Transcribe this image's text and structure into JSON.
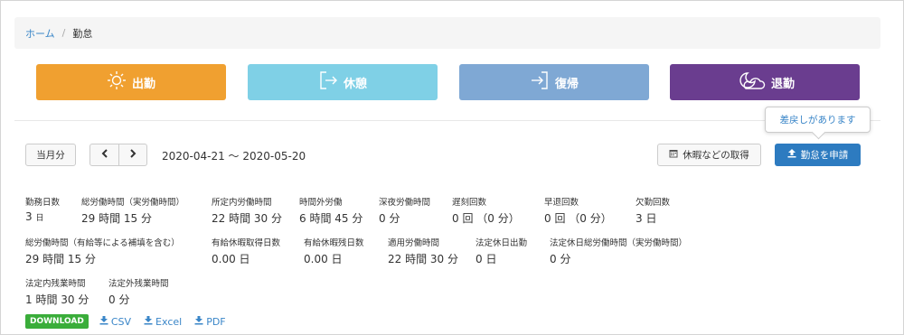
{
  "breadcrumb": {
    "home": "ホーム",
    "separator": "/",
    "current": "勤怠"
  },
  "actions": {
    "clock_in": "出勤",
    "break": "休憩",
    "return": "復帰",
    "clock_out": "退勤"
  },
  "colors": {
    "clock_in": "#f0a030",
    "break": "#7fd0e6",
    "return": "#7fa8d4",
    "clock_out": "#6a3d8f",
    "link": "#3a86c8",
    "apply": "#2d7bc0",
    "download_badge": "#3aad3a"
  },
  "tooltip": "差戻しがあります",
  "controls": {
    "this_month": "当月分",
    "prev_icon": "chevron-left-icon",
    "next_icon": "chevron-right-icon",
    "date_range": "2020-04-21 〜 2020-05-20",
    "leave_request": "休暇などの取得",
    "apply": "勤怠を申請"
  },
  "stats": [
    {
      "label": "勤務日数",
      "value": "3",
      "unit": "日"
    },
    {
      "label": "総労働時間（実労働時間）",
      "value": "29 時間 15 分"
    },
    {
      "label": "所定内労働時間",
      "value": "22 時間 30 分"
    },
    {
      "label": "時間外労働",
      "value": "6 時間 45 分"
    },
    {
      "label": "深夜労働時間",
      "value": "0 分"
    },
    {
      "label": "遅刻回数",
      "value": "0 回 （0 分）"
    },
    {
      "label": "早退回数",
      "value": "0 回 （0 分）"
    },
    {
      "label": "欠勤回数",
      "value": "3 日"
    },
    {
      "label": "総労働時間（有給等による補填を含む）",
      "value": "29 時間 15 分"
    },
    {
      "label": "有給休暇取得日数",
      "value": "0.00 日"
    },
    {
      "label": "有給休暇残日数",
      "value": "0.00 日"
    },
    {
      "label": "適用労働時間",
      "value": "22 時間 30 分"
    },
    {
      "label": "法定休日出勤",
      "value": "0 日"
    },
    {
      "label": "法定休日総労働時間（実労働時間）",
      "value": "0 分"
    },
    {
      "label": "法定内残業時間",
      "value": "1 時間 30 分"
    },
    {
      "label": "法定外残業時間",
      "value": "0 分"
    }
  ],
  "download": {
    "badge": "DOWNLOAD",
    "csv": "CSV",
    "excel": "Excel",
    "pdf": "PDF"
  }
}
